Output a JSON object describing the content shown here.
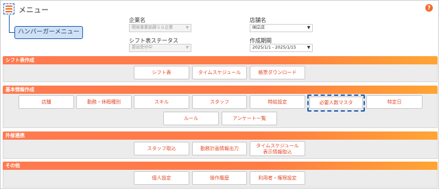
{
  "header": {
    "title": "メニュー",
    "help_icon": "?",
    "hamburger_callout": "ハンバーガーメニュー"
  },
  "filters": {
    "company": {
      "label": "企業名",
      "value": "開発事業部課ＳＧ企業"
    },
    "status": {
      "label": "シフト表ステータス",
      "value": "提出受付中"
    },
    "store": {
      "label": "店舗名",
      "value": "国立店"
    },
    "period": {
      "label": "作成期間",
      "value": "2025/1/1 - 2025/1/15"
    }
  },
  "sections": {
    "shift": {
      "title": "シフト表作成",
      "buttons": [
        "シフト表",
        "タイムスケジュール",
        "帳票ダウンロード"
      ]
    },
    "basic": {
      "title": "基本情報作成",
      "buttons": [
        "店舗",
        "勤務・休暇種別",
        "スキル",
        "スタッフ",
        "時給設定",
        "必要人数マスタ",
        "特定日",
        "ルール",
        "アンケート一覧"
      ]
    },
    "external": {
      "title": "外部連携",
      "buttons": [
        "スタッフ取込",
        "勤務計画情報出力"
      ],
      "button_two_line": {
        "line1": "タイムスケジュール",
        "line2": "表示情報取込"
      }
    },
    "other": {
      "title": "その他",
      "buttons": [
        "個人設定",
        "操作履歴",
        "利用者・権限設定"
      ]
    }
  },
  "icons": {
    "hamburger": "hamburger-menu-icon",
    "help": "help-icon",
    "dropdown": "chevron-down-icon"
  },
  "colors": {
    "accent": "#f26b2b",
    "section_header_start": "#ff7a50",
    "section_header_end": "#ffa534",
    "button_text": "#e04a2a",
    "highlight": "#1f5fb5",
    "callout_bg": "#cfe1f5"
  }
}
